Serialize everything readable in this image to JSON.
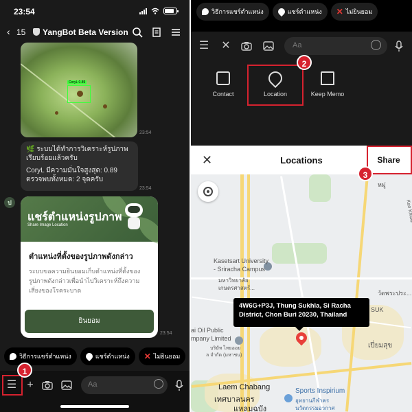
{
  "left": {
    "status": {
      "time": "23:54"
    },
    "header": {
      "back_count": "15",
      "title": "YangBot Beta Version"
    },
    "image_ts": "23:54",
    "image_tag": "CoryL 0.89",
    "bubble": {
      "line1": "🌿 ระบบได้ทำการวิเคราะห์รูปภาพเรียบร้อยแล้วครับ",
      "line2": "CoryL มีความมั่นใจสูงสุด: 0.89 ตรวจพบทั้งหมด: 2 จุดครับ",
      "ts": "23:54"
    },
    "avatar": "ป",
    "card": {
      "banner_title": "แชร์ตำแหน่งรูปภาพ",
      "banner_sub": "Share Image Location",
      "title": "ตำแหน่งที่ตั้งของรูปภาพดังกล่าว",
      "desc": "ระบบขอความยินยอมเก็บตำแหน่งที่ตั้งของรูปภาพดังกล่าวเพื่อนำไปวิเคราะห์ถึงความเสี่ยงของโรคระบาด",
      "button": "ยินยอม",
      "ts": "23:54"
    },
    "quick_replies": [
      "วิธีการแชร์ตำแหน่ง",
      "แชร์ตำแหน่ง",
      "ไม่ยินยอม"
    ],
    "input_placeholder": "Aa",
    "badge": "1"
  },
  "right": {
    "quick_replies": [
      "วิธีการแชร์ตำแหน่ง",
      "แชร์ตำแหน่ง",
      "ไม่ยินยอม"
    ],
    "input_placeholder": "Aa",
    "menu": [
      "Contact",
      "Location",
      "Keep Memo"
    ],
    "badge_location": "2",
    "sheet": {
      "title": "Locations",
      "share": "Share",
      "badge": "3"
    },
    "map": {
      "address": "4W6G+P3J, Thung Sukhla, Si Racha District, Chon Buri 20230, Thailand",
      "labels": {
        "kasetsart": "Kasetsart University",
        "sriracha": "- Sriracha Campus",
        "thai_kaset": "มหาวิทยาลัย",
        "thai_kaset2": "เกษตรศาสตร์...",
        "wat": "วัดพระประ...",
        "suk": "SUK",
        "poem": "เปี่ยมสุข",
        "oil": "ai Oil Public",
        "oil2": "mpany Limited",
        "oil3": "บริษัท ไทยออย",
        "oil4": "ล จำกัด (มหาชน)",
        "laem": "Laem Chabang",
        "laem_th": "เทศบาลนคร",
        "laem_th2": "แหลมฉบัง",
        "sports": "Sports Inspirium",
        "sports_th": "อุทยานกีฬาคร",
        "sports_th2": "นวัตกรรมอวกาศ",
        "hmu": "หมู่",
        "kao": "Kao Khiaw"
      }
    }
  }
}
